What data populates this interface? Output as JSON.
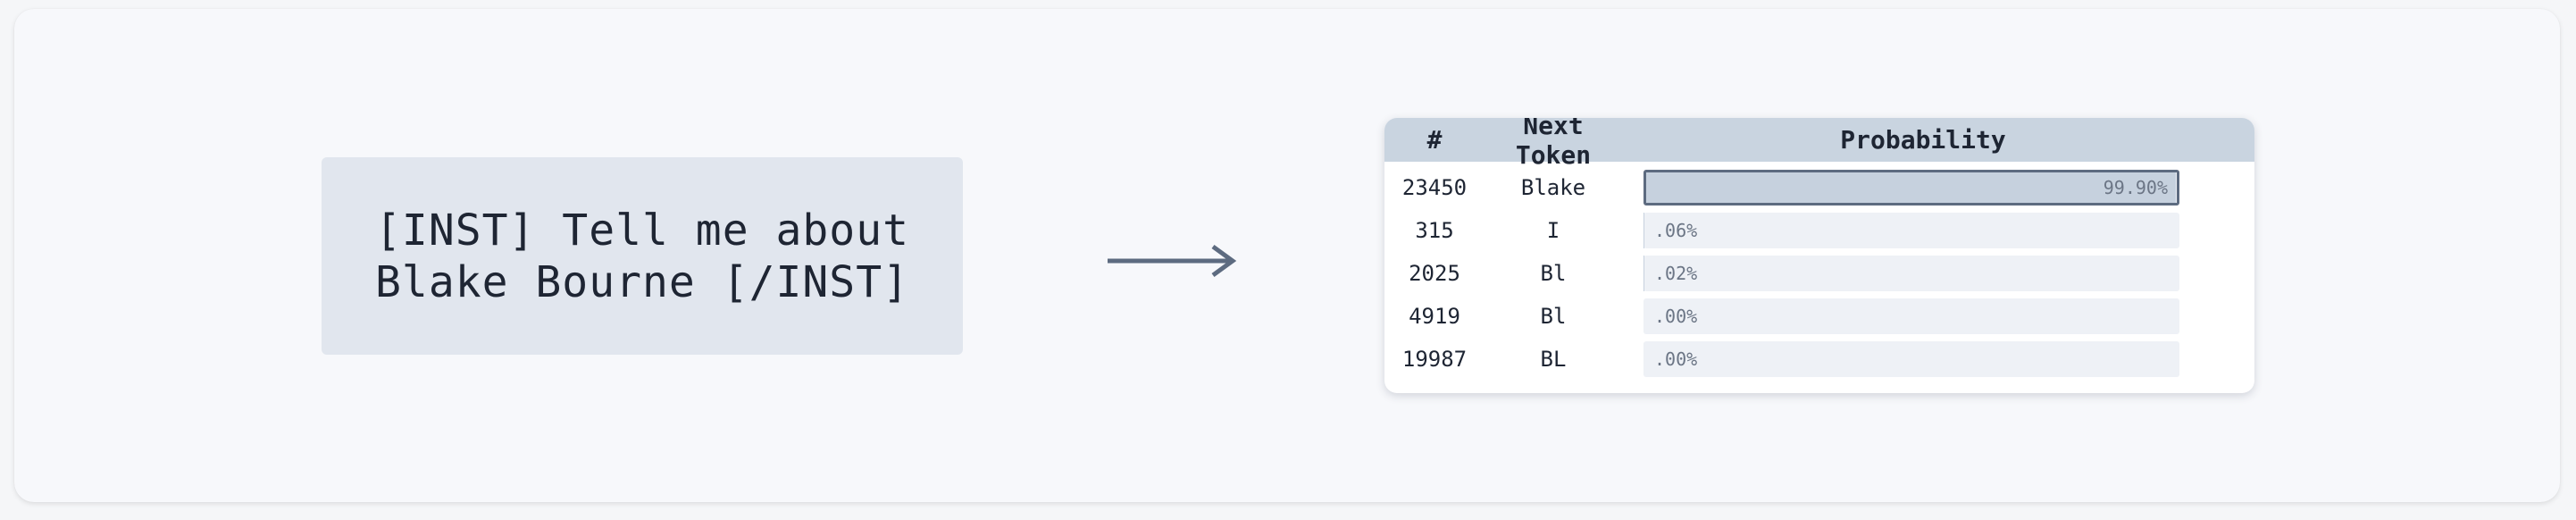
{
  "prompt": {
    "line1": "[INST] Tell me about",
    "line2": "Blake Bourne [/INST]"
  },
  "table": {
    "headers": {
      "num": "#",
      "token": "Next Token",
      "probability": "Probability"
    },
    "rows": [
      {
        "id": "23450",
        "token": "Blake",
        "prob_label": "99.90%",
        "prob": 0.999
      },
      {
        "id": "315",
        "token": "I",
        "prob_label": ".06%",
        "prob": 0.0006
      },
      {
        "id": "2025",
        "token": "Bl",
        "prob_label": ".02%",
        "prob": 0.0002
      },
      {
        "id": "4919",
        "token": "Bl",
        "prob_label": ".00%",
        "prob": 0.0
      },
      {
        "id": "19987",
        "token": "BL",
        "prob_label": ".00%",
        "prob": 0.0
      }
    ]
  },
  "colors": {
    "accent": "#5d6b80",
    "header_bg": "#c9d4e0",
    "bar_fill": "#c6d1de",
    "prompt_bg": "#e1e6ee"
  },
  "icons": {
    "arrow": "right-arrow-icon"
  }
}
